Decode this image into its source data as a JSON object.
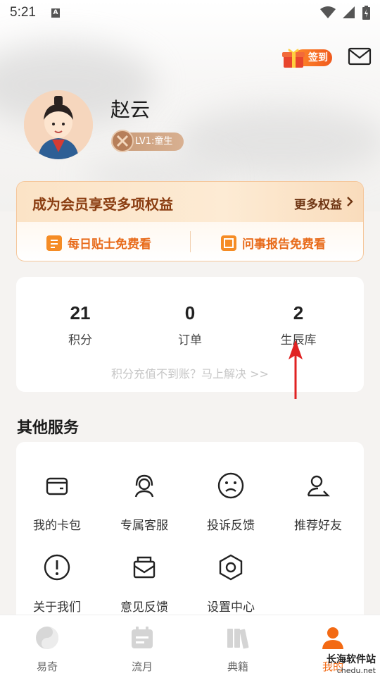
{
  "status_bar": {
    "time": "5:21",
    "notification_icon": "a-icon"
  },
  "header": {
    "signin_label": "签到",
    "mail_icon": "mail-icon"
  },
  "profile": {
    "name": "赵云",
    "level": "LV1:童生"
  },
  "vip": {
    "title": "成为会员享受多项权益",
    "more_label": "更多权益",
    "benefit_1": "每日贴士免费看",
    "benefit_2": "问事报告免费看"
  },
  "stats": {
    "items": [
      {
        "value": "21",
        "label": "积分"
      },
      {
        "value": "0",
        "label": "订单"
      },
      {
        "value": "2",
        "label": "生辰库"
      }
    ],
    "tip": "积分充值不到账？马上解决 >>"
  },
  "services": {
    "title": "其他服务",
    "items": [
      {
        "label": "我的卡包",
        "icon": "wallet-icon"
      },
      {
        "label": "专属客服",
        "icon": "headset-icon"
      },
      {
        "label": "投诉反馈",
        "icon": "sad-face-icon"
      },
      {
        "label": "推荐好友",
        "icon": "share-user-icon"
      },
      {
        "label": "关于我们",
        "icon": "info-icon"
      },
      {
        "label": "意见反馈",
        "icon": "mail-feedback-icon"
      },
      {
        "label": "设置中心",
        "icon": "settings-icon"
      }
    ]
  },
  "nav": {
    "items": [
      {
        "label": "易奇",
        "icon": "yinyang-icon"
      },
      {
        "label": "流月",
        "icon": "calendar-icon"
      },
      {
        "label": "典籍",
        "icon": "books-icon"
      },
      {
        "label": "我的",
        "icon": "user-icon"
      }
    ],
    "active_index": 3
  },
  "watermark": {
    "line1": "长海软件站",
    "line2": "chedu.net"
  },
  "colors": {
    "accent": "#f36a14",
    "vip_text": "#8b3e12"
  }
}
